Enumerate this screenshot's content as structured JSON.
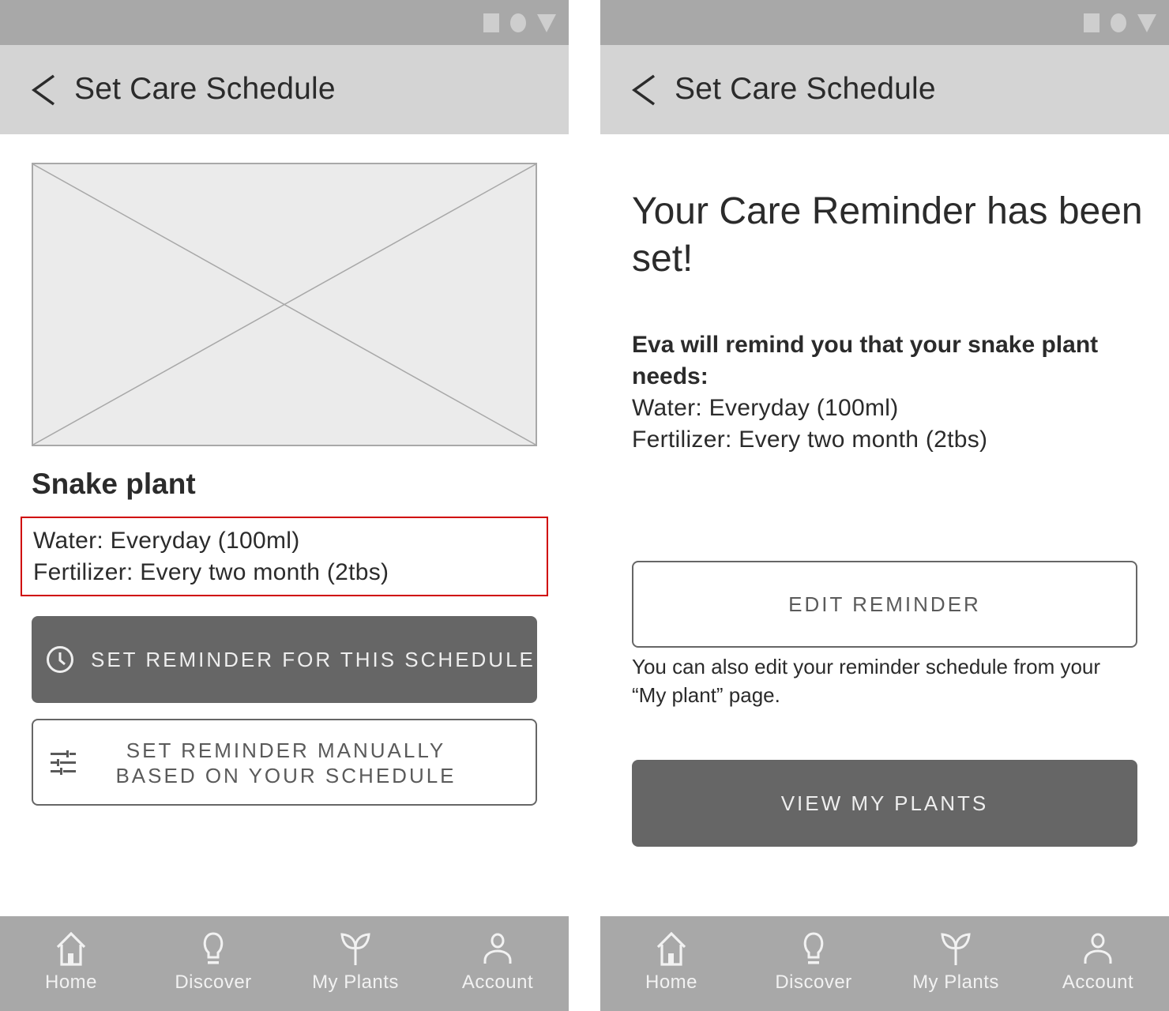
{
  "screens": {
    "left": {
      "header": {
        "title": "Set Care Schedule"
      },
      "plant": {
        "name": "Snake plant",
        "schedule": {
          "water": "Water: Everyday (100ml)",
          "fertilizer": "Fertilizer: Every two month (2tbs)"
        }
      },
      "buttons": {
        "set_reminder": "SET REMINDER FOR THIS SCHEDULE",
        "manual_line1": "SET REMINDER MANUALLY",
        "manual_line2": "BASED ON YOUR SCHEDULE"
      }
    },
    "right": {
      "header": {
        "title": "Set Care Schedule"
      },
      "success_title": "Your Care Reminder has been set!",
      "remind_intro": "Eva will remind you that your snake plant needs:",
      "water": "Water: Everyday (100ml)",
      "fertilizer": "Fertilizer: Every two month (2tbs)",
      "buttons": {
        "edit": "EDIT REMINDER",
        "view": "VIEW MY PLANTS"
      },
      "edit_note": "You can also edit your reminder schedule from your  “My plant” page."
    }
  },
  "nav": {
    "items": [
      {
        "label": "Home",
        "icon": "home-icon"
      },
      {
        "label": "Discover",
        "icon": "lightbulb-icon"
      },
      {
        "label": "My Plants",
        "icon": "sprout-icon"
      },
      {
        "label": "Account",
        "icon": "person-icon"
      }
    ]
  },
  "colors": {
    "statusbar": "#a8a8a8",
    "appbar": "#d4d4d4",
    "primary_button": "#666666",
    "highlight_border": "#d00000",
    "bottom_nav": "#a8a8a8"
  }
}
